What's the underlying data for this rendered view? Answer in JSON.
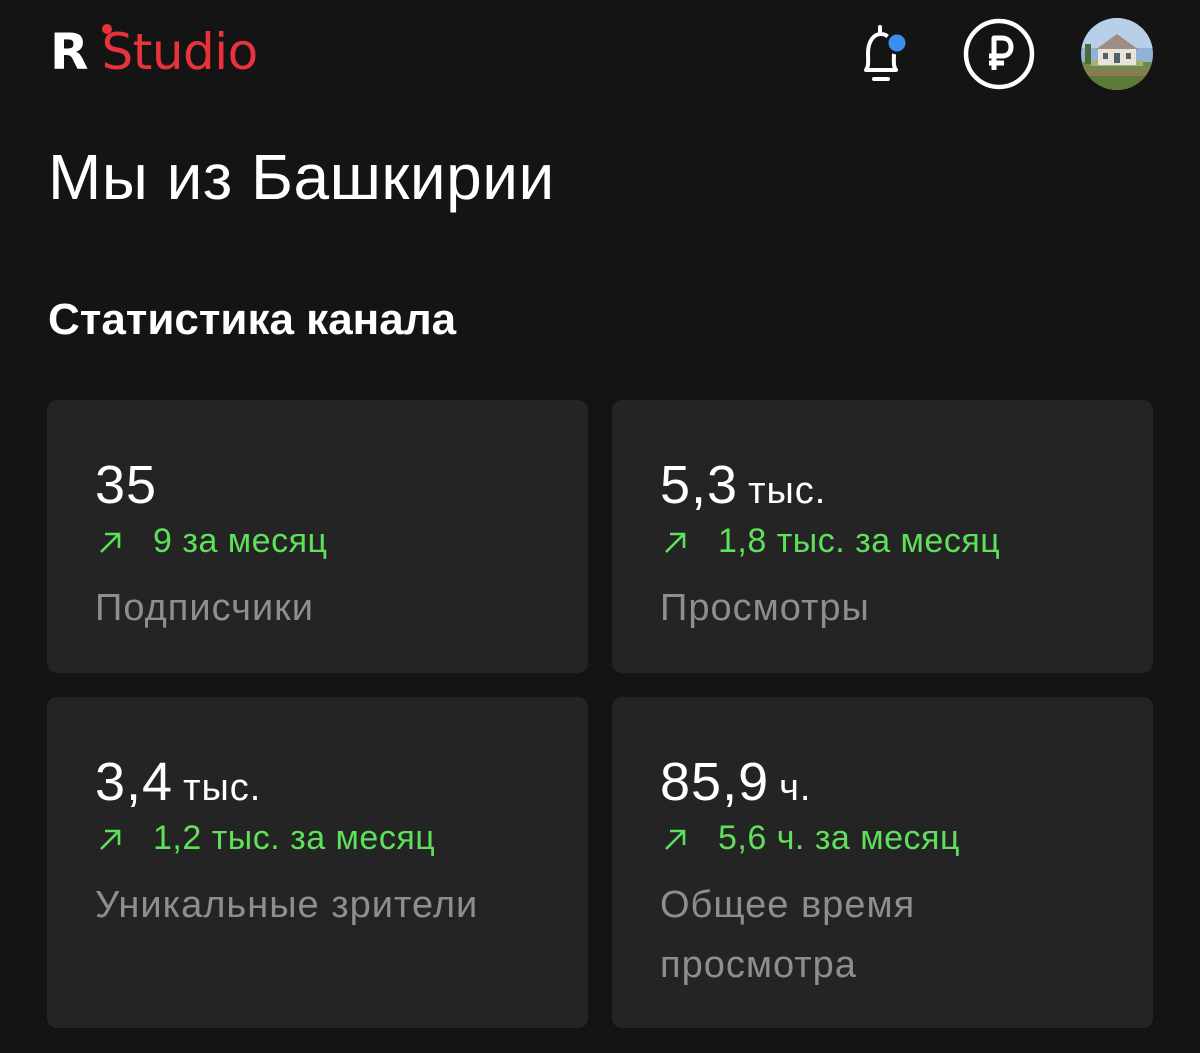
{
  "app": {
    "logo_letter": "R",
    "logo_word": "Studio",
    "accent_color": "#e8323c",
    "notification_dot_color": "#3b8ff0",
    "icons": [
      "bell-icon",
      "ruble-icon",
      "avatar"
    ]
  },
  "channel": {
    "title": "Мы из Башкирии"
  },
  "stats": {
    "section_title": "Статистика канала",
    "cards": [
      {
        "value": "35",
        "unit": "",
        "delta": "9 за месяц",
        "label": "Подписчики"
      },
      {
        "value": "5,3",
        "unit": "тыс.",
        "delta": "1,8 тыс. за месяц",
        "label": "Просмотры"
      },
      {
        "value": "3,4",
        "unit": "тыс.",
        "delta": "1,2 тыс. за месяц",
        "label": "Уникальные зрители"
      },
      {
        "value": "85,9",
        "unit": "ч.",
        "delta": "5,6 ч. за месяц",
        "label": "Общее время просмотра"
      }
    ]
  }
}
